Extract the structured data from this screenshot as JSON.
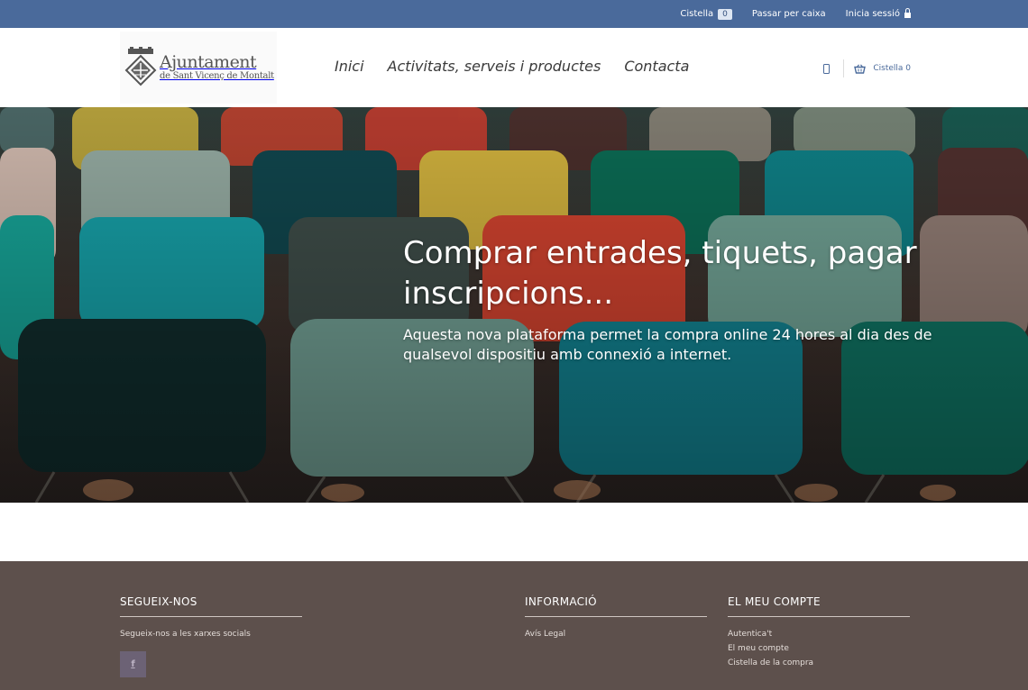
{
  "topbar": {
    "cart_label": "Cistella",
    "cart_count": "0",
    "checkout_label": "Passar per caixa",
    "login_label": "Inicia sessió"
  },
  "logo": {
    "line1": "Ajuntament",
    "line2": "de Sant Vicenç de Montalt"
  },
  "nav": {
    "items": [
      {
        "label": "Inici"
      },
      {
        "label": "Activitats, serveis i productes"
      },
      {
        "label": "Contacta"
      }
    ]
  },
  "header": {
    "cart_label": "Cistella 0"
  },
  "hero": {
    "title": "Comprar entrades, tiquets, pagar inscripcions...",
    "subtitle": "Aquesta nova plataforma permet la compra online 24 hores al dia des de qualsevol dispositiu amb connexió a internet."
  },
  "footer": {
    "follow": {
      "heading": "SEGUEIX-NOS",
      "text": "Segueix-nos a les xarxes socials",
      "facebook_glyph": "f"
    },
    "info": {
      "heading": "INFORMACIÓ",
      "links": [
        "Avís Legal"
      ]
    },
    "account": {
      "heading": "EL MEU COMPTE",
      "links": [
        "Autentica't",
        "El meu compte",
        "Cistella de la compra"
      ]
    }
  },
  "colors": {
    "brand_blue": "#4a6a9b",
    "footer_bg": "#5d504c"
  },
  "icons": [
    "lock-icon",
    "phone-icon",
    "basket-icon",
    "facebook-icon",
    "coat-of-arms-icon"
  ]
}
